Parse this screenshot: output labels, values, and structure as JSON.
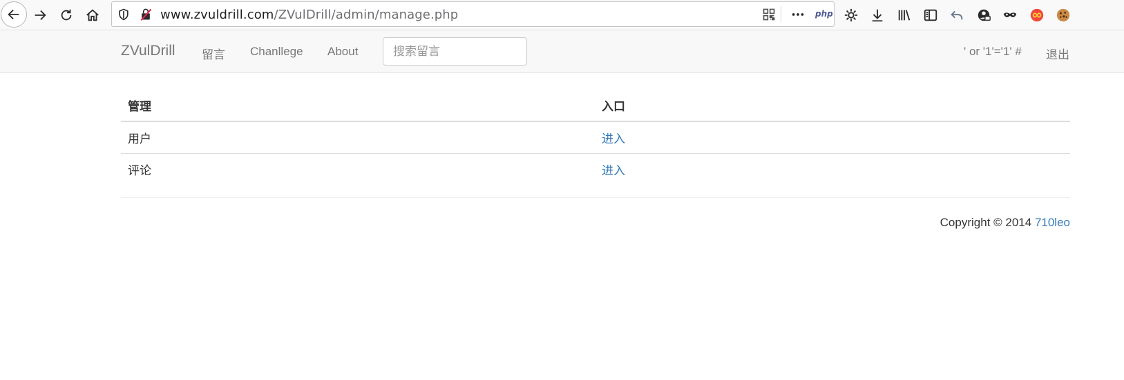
{
  "browser": {
    "url_domain": "www.zvuldrill.com",
    "url_path": "/ZVulDrill/admin/manage.php",
    "url_prefix": "www.",
    "url_domain_main": "zvuldrill.com",
    "page_action_label": "php",
    "icons": {
      "back": "back-arrow-icon",
      "forward": "forward-arrow-icon",
      "reload": "reload-icon",
      "home": "home-icon",
      "tracking": "shield-icon",
      "insecure": "insecure-lock-icon",
      "qr": "qr-code-icon",
      "more": "more-dots-icon",
      "extensions": [
        "settings-sun-icon",
        "download-icon",
        "library-icon",
        "sidebar-icon",
        "undo-arrow-icon",
        "account-icon",
        "private-mask-icon",
        "infinity-icon",
        "cookie-icon"
      ]
    }
  },
  "navbar": {
    "brand": "ZVulDrill",
    "links": [
      "留言",
      "Chanllege",
      "About"
    ],
    "search_placeholder": "搜索留言",
    "user": "' or '1'='1' #",
    "logout": "退出"
  },
  "table": {
    "headers": [
      "管理",
      "入口"
    ],
    "rows": [
      {
        "name": "用户",
        "action": "进入"
      },
      {
        "name": "评论",
        "action": "进入"
      }
    ]
  },
  "footer": {
    "copyright": "Copyright © 2014 ",
    "author": "710leo"
  },
  "colors": {
    "link": "#337ab7",
    "navbar_bg": "#f8f8f8",
    "nav_text": "#777777"
  }
}
